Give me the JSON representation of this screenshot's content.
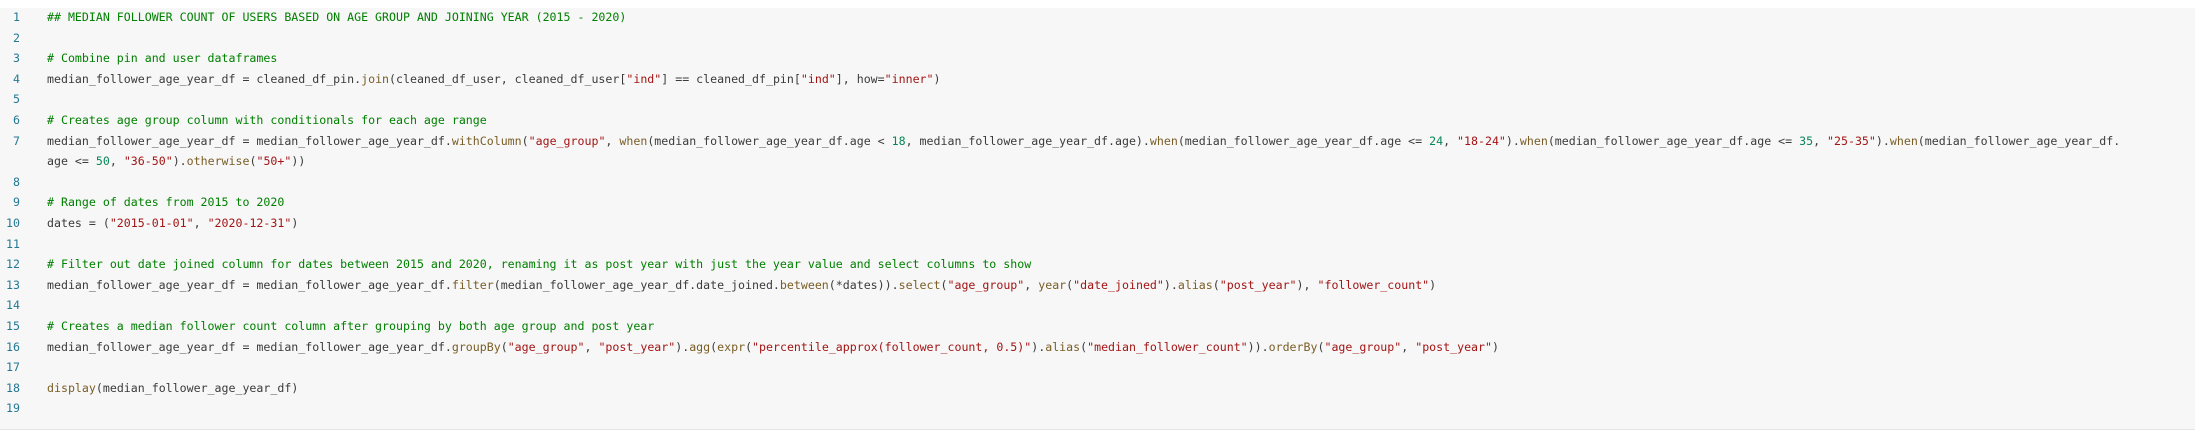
{
  "editor": {
    "lines": [
      {
        "no": "1",
        "segments": [
          {
            "t": "## MEDIAN FOLLOWER COUNT OF USERS BASED ON AGE GROUP AND JOINING YEAR (2015 - 2020)",
            "c": "cmt"
          }
        ]
      },
      {
        "no": "2",
        "segments": []
      },
      {
        "no": "3",
        "segments": [
          {
            "t": "# Combine pin and user dataframes",
            "c": "cmt"
          }
        ]
      },
      {
        "no": "4",
        "segments": [
          {
            "t": "median_follower_age_year_df = cleaned_df_pin.",
            "c": ""
          },
          {
            "t": "join",
            "c": "fn"
          },
          {
            "t": "(cleaned_df_user, cleaned_df_user[",
            "c": ""
          },
          {
            "t": "\"ind\"",
            "c": "str"
          },
          {
            "t": "] == cleaned_df_pin[",
            "c": ""
          },
          {
            "t": "\"ind\"",
            "c": "str"
          },
          {
            "t": "], how=",
            "c": ""
          },
          {
            "t": "\"inner\"",
            "c": "str"
          },
          {
            "t": ")",
            "c": ""
          }
        ]
      },
      {
        "no": "5",
        "segments": []
      },
      {
        "no": "6",
        "segments": [
          {
            "t": "# Creates age group column with conditionals for each age range",
            "c": "cmt"
          }
        ]
      },
      {
        "no": "7",
        "segments": [
          {
            "t": "median_follower_age_year_df = median_follower_age_year_df.",
            "c": ""
          },
          {
            "t": "withColumn",
            "c": "fn"
          },
          {
            "t": "(",
            "c": ""
          },
          {
            "t": "\"age_group\"",
            "c": "str"
          },
          {
            "t": ", ",
            "c": ""
          },
          {
            "t": "when",
            "c": "fn"
          },
          {
            "t": "(median_follower_age_year_df.age < ",
            "c": ""
          },
          {
            "t": "18",
            "c": "num"
          },
          {
            "t": ", median_follower_age_year_df.age).",
            "c": ""
          },
          {
            "t": "when",
            "c": "fn"
          },
          {
            "t": "(median_follower_age_year_df.age <= ",
            "c": ""
          },
          {
            "t": "24",
            "c": "num"
          },
          {
            "t": ", ",
            "c": ""
          },
          {
            "t": "\"18-24\"",
            "c": "str"
          },
          {
            "t": ").",
            "c": ""
          },
          {
            "t": "when",
            "c": "fn"
          },
          {
            "t": "(median_follower_age_year_df.age <= ",
            "c": ""
          },
          {
            "t": "35",
            "c": "num"
          },
          {
            "t": ", ",
            "c": ""
          },
          {
            "t": "\"25-35\"",
            "c": "str"
          },
          {
            "t": ").",
            "c": ""
          },
          {
            "t": "when",
            "c": "fn"
          },
          {
            "t": "(median_follower_age_year_df.",
            "c": ""
          }
        ]
      },
      {
        "no": "",
        "segments": [
          {
            "t": "age <= ",
            "c": ""
          },
          {
            "t": "50",
            "c": "num"
          },
          {
            "t": ", ",
            "c": ""
          },
          {
            "t": "\"36-50\"",
            "c": "str"
          },
          {
            "t": ").",
            "c": ""
          },
          {
            "t": "otherwise",
            "c": "fn"
          },
          {
            "t": "(",
            "c": ""
          },
          {
            "t": "\"50+\"",
            "c": "str"
          },
          {
            "t": "))",
            "c": ""
          }
        ]
      },
      {
        "no": "8",
        "segments": []
      },
      {
        "no": "9",
        "segments": [
          {
            "t": "# Range of dates from 2015 to 2020",
            "c": "cmt"
          }
        ]
      },
      {
        "no": "10",
        "segments": [
          {
            "t": "dates = (",
            "c": ""
          },
          {
            "t": "\"2015-01-01\"",
            "c": "str"
          },
          {
            "t": ", ",
            "c": ""
          },
          {
            "t": "\"2020-12-31\"",
            "c": "str"
          },
          {
            "t": ")",
            "c": ""
          }
        ]
      },
      {
        "no": "11",
        "segments": []
      },
      {
        "no": "12",
        "segments": [
          {
            "t": "# Filter out date joined column for dates between 2015 and 2020, renaming it as post year with just the year value and select columns to show",
            "c": "cmt"
          }
        ]
      },
      {
        "no": "13",
        "segments": [
          {
            "t": "median_follower_age_year_df = median_follower_age_year_df.",
            "c": ""
          },
          {
            "t": "filter",
            "c": "fn"
          },
          {
            "t": "(median_follower_age_year_df.date_joined.",
            "c": ""
          },
          {
            "t": "between",
            "c": "fn"
          },
          {
            "t": "(*dates)).",
            "c": ""
          },
          {
            "t": "select",
            "c": "fn"
          },
          {
            "t": "(",
            "c": ""
          },
          {
            "t": "\"age_group\"",
            "c": "str"
          },
          {
            "t": ", ",
            "c": ""
          },
          {
            "t": "year",
            "c": "fn"
          },
          {
            "t": "(",
            "c": ""
          },
          {
            "t": "\"date_joined\"",
            "c": "str"
          },
          {
            "t": ").",
            "c": ""
          },
          {
            "t": "alias",
            "c": "fn"
          },
          {
            "t": "(",
            "c": ""
          },
          {
            "t": "\"post_year\"",
            "c": "str"
          },
          {
            "t": "), ",
            "c": ""
          },
          {
            "t": "\"follower_count\"",
            "c": "str"
          },
          {
            "t": ")",
            "c": ""
          }
        ]
      },
      {
        "no": "14",
        "segments": []
      },
      {
        "no": "15",
        "segments": [
          {
            "t": "# Creates a median follower count column after grouping by both age group and post year",
            "c": "cmt"
          }
        ]
      },
      {
        "no": "16",
        "segments": [
          {
            "t": "median_follower_age_year_df = median_follower_age_year_df.",
            "c": ""
          },
          {
            "t": "groupBy",
            "c": "fn"
          },
          {
            "t": "(",
            "c": ""
          },
          {
            "t": "\"age_group\"",
            "c": "str"
          },
          {
            "t": ", ",
            "c": ""
          },
          {
            "t": "\"post_year\"",
            "c": "str"
          },
          {
            "t": ").",
            "c": ""
          },
          {
            "t": "agg",
            "c": "fn"
          },
          {
            "t": "(",
            "c": ""
          },
          {
            "t": "expr",
            "c": "fn"
          },
          {
            "t": "(",
            "c": ""
          },
          {
            "t": "\"percentile_approx(follower_count, 0.5)\"",
            "c": "str"
          },
          {
            "t": ").",
            "c": ""
          },
          {
            "t": "alias",
            "c": "fn"
          },
          {
            "t": "(",
            "c": ""
          },
          {
            "t": "\"median_follower_count\"",
            "c": "str"
          },
          {
            "t": ")).",
            "c": ""
          },
          {
            "t": "orderBy",
            "c": "fn"
          },
          {
            "t": "(",
            "c": ""
          },
          {
            "t": "\"age_group\"",
            "c": "str"
          },
          {
            "t": ", ",
            "c": ""
          },
          {
            "t": "\"post_year\"",
            "c": "str"
          },
          {
            "t": ")",
            "c": ""
          }
        ]
      },
      {
        "no": "17",
        "segments": []
      },
      {
        "no": "18",
        "segments": [
          {
            "t": "display",
            "c": "fn"
          },
          {
            "t": "(median_follower_age_year_df)",
            "c": ""
          }
        ]
      },
      {
        "no": "19",
        "segments": []
      }
    ]
  }
}
